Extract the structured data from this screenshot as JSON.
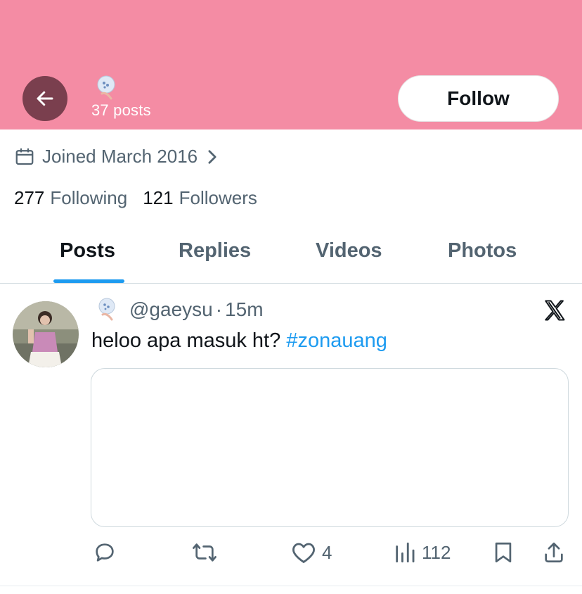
{
  "header": {
    "background_color": "#f48ca4",
    "back_icon": "arrow-left-icon",
    "post_count": "37 posts",
    "follow_label": "Follow"
  },
  "profile": {
    "joined": "Joined March 2016",
    "following_count": "277",
    "following_label": "Following",
    "followers_count": "121",
    "followers_label": "Followers"
  },
  "tabs": [
    {
      "label": "Posts",
      "active": true
    },
    {
      "label": "Replies",
      "active": false
    },
    {
      "label": "Videos",
      "active": false
    },
    {
      "label": "Photos",
      "active": false
    }
  ],
  "post": {
    "handle": "@gaeysu",
    "separator": "·",
    "time": "15m",
    "text": "heloo apa masuk ht?",
    "hashtag": "#zonauang",
    "likes": "4",
    "views": "112"
  },
  "colors": {
    "accent": "#1d9bf0",
    "secondary_text": "#536471",
    "primary_text": "#0f1419"
  }
}
